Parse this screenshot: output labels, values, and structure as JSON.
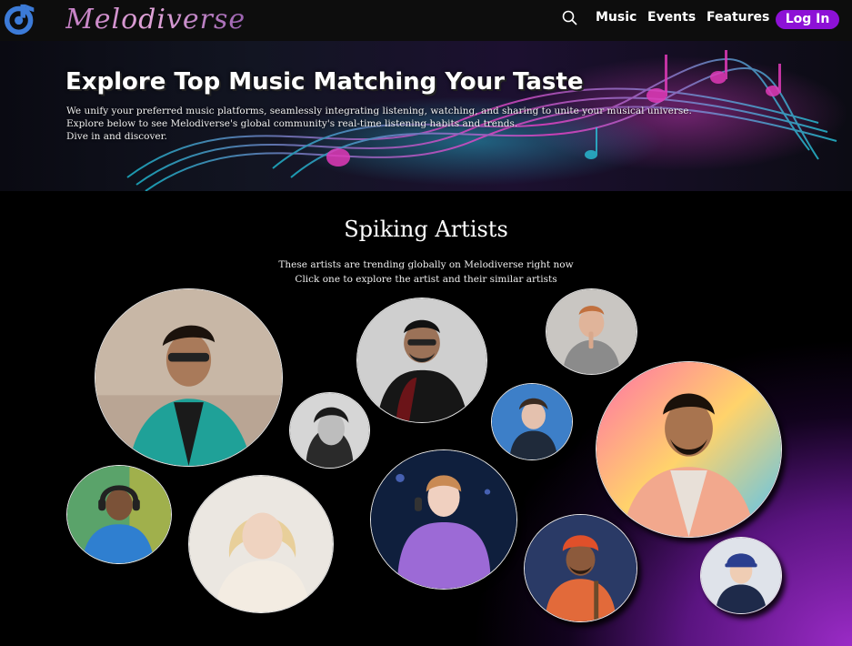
{
  "nav": {
    "brand": "Melodiverse",
    "links": [
      "Music",
      "Events",
      "Features"
    ],
    "login_label": "Log In",
    "logo_icon": "music-note-logo-icon",
    "search_icon": "search-icon"
  },
  "hero": {
    "title": "Explore Top Music Matching Your Taste",
    "lines": [
      "We unify your preferred music platforms, seamlessly integrating listening, watching, and sharing to unite your musical universe.",
      "Explore below to see Melodiverse's global community's real-time listening habits and trends.",
      "Dive in and discover."
    ]
  },
  "spiking": {
    "title": "Spiking Artists",
    "subtitle_lines": [
      "These artists are trending globally on Melodiverse right now",
      "Click one to explore the artist and their similar artists"
    ]
  },
  "colors": {
    "accent": "#8d11d6",
    "background": "#000000",
    "glow": "#9a2bc6"
  }
}
